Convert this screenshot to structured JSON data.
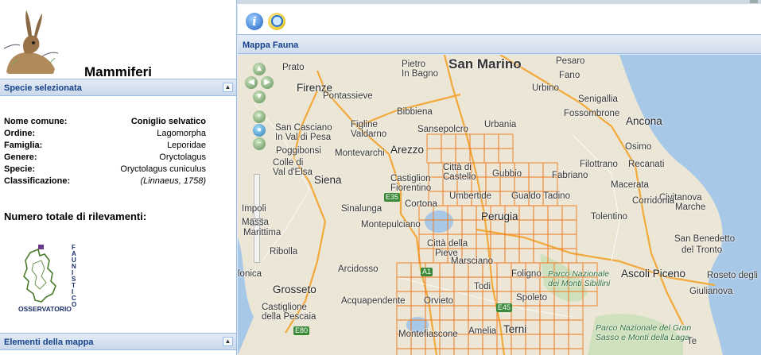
{
  "left_panel": {
    "group_title": "Mammiferi",
    "species_header": "Specie selezionata",
    "species_info": [
      {
        "label": "Nome comune:",
        "value": "Coniglio selvatico",
        "style": "bold"
      },
      {
        "label": "Ordine:",
        "value": "Lagomorpha",
        "style": ""
      },
      {
        "label": "Famiglia:",
        "value": "Leporidae",
        "style": ""
      },
      {
        "label": "Genere:",
        "value": "Oryctolagus",
        "style": ""
      },
      {
        "label": "Specie:",
        "value": "Oryctolagus cuniculus",
        "style": ""
      },
      {
        "label": "Classificazione:",
        "value": "(Linnaeus, 1758)",
        "style": "italic"
      }
    ],
    "total_label": "Numero totale di rilevamenti:",
    "observatory_logo": {
      "vertical_text": "FAUNISTICO",
      "bottom_text": "OSSERVATORIO"
    },
    "elements_header": "Elementi della mappa"
  },
  "toolbar": {
    "info_icon": "info-icon",
    "zoom_icon": "magnifier-icon"
  },
  "map_panel": {
    "title": "Mappa Fauna",
    "places": [
      {
        "name": "San Marino",
        "cls": "huge"
      },
      {
        "name": "Pesaro",
        "cls": ""
      },
      {
        "name": "Fano",
        "cls": ""
      },
      {
        "name": "Pietro",
        "cls": ""
      },
      {
        "name": "In Bagno",
        "cls": ""
      },
      {
        "name": "Prato",
        "cls": ""
      },
      {
        "name": "Urbino",
        "cls": ""
      },
      {
        "name": "Senigallia",
        "cls": ""
      },
      {
        "name": "Firenze",
        "cls": "big"
      },
      {
        "name": "Pontassieve",
        "cls": ""
      },
      {
        "name": "Bibbiena",
        "cls": ""
      },
      {
        "name": "Fossombrone",
        "cls": ""
      },
      {
        "name": "Ancona",
        "cls": "big"
      },
      {
        "name": "Sansepolcro",
        "cls": ""
      },
      {
        "name": "Urbania",
        "cls": ""
      },
      {
        "name": "San Casciano",
        "cls": ""
      },
      {
        "name": "In Val di Pesa",
        "cls": ""
      },
      {
        "name": "Figline",
        "cls": ""
      },
      {
        "name": "Valdarno",
        "cls": ""
      },
      {
        "name": "Osimo",
        "cls": ""
      },
      {
        "name": "Poggibonsi",
        "cls": ""
      },
      {
        "name": "Montevarchi",
        "cls": ""
      },
      {
        "name": "Arezzo",
        "cls": "big"
      },
      {
        "name": "Filottrano",
        "cls": ""
      },
      {
        "name": "Recanati",
        "cls": ""
      },
      {
        "name": "Colle di",
        "cls": ""
      },
      {
        "name": "Val d'Elsa",
        "cls": ""
      },
      {
        "name": "Città di",
        "cls": ""
      },
      {
        "name": "Castello",
        "cls": ""
      },
      {
        "name": "Gubbio",
        "cls": ""
      },
      {
        "name": "Fabriano",
        "cls": ""
      },
      {
        "name": "Castiglion",
        "cls": ""
      },
      {
        "name": "Fiorentino",
        "cls": ""
      },
      {
        "name": "Siena",
        "cls": "big"
      },
      {
        "name": "Umbertide",
        "cls": ""
      },
      {
        "name": "Gualdo Tadino",
        "cls": ""
      },
      {
        "name": "Macerata",
        "cls": ""
      },
      {
        "name": "Civitanova",
        "cls": ""
      },
      {
        "name": "Marche",
        "cls": ""
      },
      {
        "name": "Corridonia",
        "cls": ""
      },
      {
        "name": "Cortona",
        "cls": ""
      },
      {
        "name": "Sinalunga",
        "cls": ""
      },
      {
        "name": "Perugia",
        "cls": "big"
      },
      {
        "name": "Tolentino",
        "cls": ""
      },
      {
        "name": "Montepulciano",
        "cls": ""
      },
      {
        "name": "San Benedetto",
        "cls": ""
      },
      {
        "name": "del Tronto",
        "cls": ""
      },
      {
        "name": "Foligno",
        "cls": ""
      },
      {
        "name": "Città della",
        "cls": ""
      },
      {
        "name": "Pieve",
        "cls": ""
      },
      {
        "name": "Ribolla",
        "cls": ""
      },
      {
        "name": "Marsciano",
        "cls": ""
      },
      {
        "name": "Arcidosso",
        "cls": ""
      },
      {
        "name": "Parco Nazionale",
        "cls": "park"
      },
      {
        "name": "dei Monti Sibillini",
        "cls": "park"
      },
      {
        "name": "Ascoli Piceno",
        "cls": "big"
      },
      {
        "name": "Roseto degli",
        "cls": ""
      },
      {
        "name": "Todi",
        "cls": ""
      },
      {
        "name": "Giulianova",
        "cls": ""
      },
      {
        "name": "Grosseto",
        "cls": "big"
      },
      {
        "name": "Acquapendente",
        "cls": ""
      },
      {
        "name": "Orvieto",
        "cls": ""
      },
      {
        "name": "Spoleto",
        "cls": ""
      },
      {
        "name": "Castiglione",
        "cls": ""
      },
      {
        "name": "della Pescaia",
        "cls": ""
      },
      {
        "name": "Terni",
        "cls": "big"
      },
      {
        "name": "Parco Nazionale del Gran",
        "cls": "park"
      },
      {
        "name": "Sasso e Monti della Laga",
        "cls": "park"
      },
      {
        "name": "Montefiascone",
        "cls": ""
      },
      {
        "name": "Amelia",
        "cls": ""
      },
      {
        "name": "Massa",
        "cls": ""
      },
      {
        "name": "Marittima",
        "cls": ""
      },
      {
        "name": "Impoli",
        "cls": ""
      },
      {
        "name": "lonica",
        "cls": ""
      },
      {
        "name": "Te",
        "cls": ""
      }
    ],
    "road_shields": [
      "E35",
      "A1",
      "E45",
      "E80"
    ]
  },
  "colors": {
    "header_text": "#15428b",
    "panel_border": "#99bbe8",
    "grid": "#f07a1e",
    "road": "#f2a93b",
    "sea": "#a8c8e8"
  }
}
